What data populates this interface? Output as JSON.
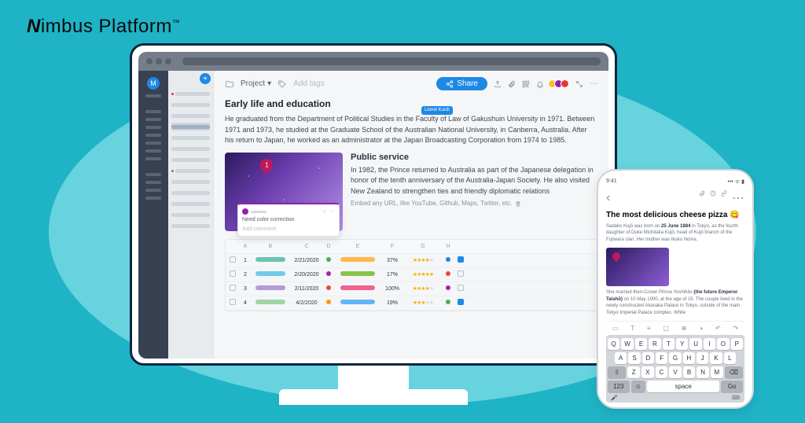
{
  "brand": {
    "name": "Nimbus Platform",
    "tm": "™"
  },
  "rail": {
    "initial": "M"
  },
  "notelist": {
    "add": "+"
  },
  "toolbar": {
    "breadcrumb": "Project",
    "add_tags": "Add tags",
    "share": "Share"
  },
  "doc": {
    "h1": "Early life and education",
    "p1": "He graduated from the Department of Political Studies in the Faculty of Law of Gakushuin University in 1971. Between 1971 and 1973, he studied at the Graduate School of the Australian National University, in Canberra, Australia. After his return to Japan, he worked as an administrator at the Japan Broadcasting Corporation from 1974 to 1985.",
    "cursor_user": "Lionel Kurdi",
    "h2": "Public service",
    "p2": "In 1982, the Prince returned to Australia as part of the Japanese delegation in honor of the tenth anniversary of the Australia-Japan Society. He also visited New Zealand to strengthen ties and friendly diplomatic relations",
    "embed_placeholder": "Embed any URL, like YouTube, Github, Maps, Twitter, etc.",
    "pin": "1"
  },
  "comment": {
    "text": "Need color correction",
    "add": "Add comment"
  },
  "table": {
    "headers": [
      "",
      "A",
      "B",
      "C",
      "D",
      "E",
      "F",
      "G",
      "H",
      ""
    ],
    "rows": [
      {
        "n": "1",
        "pillB": "#69c5b0",
        "date": "2/21/2020",
        "dotD": "#4caf50",
        "pillE": "#ffb74d",
        "pct": "37%",
        "stars": 4,
        "dotH": "#1e88e5",
        "chk": true
      },
      {
        "n": "2",
        "pillB": "#73c9e8",
        "date": "2/20/2020",
        "dotD": "#9c27b0",
        "pillE": "#8bc34a",
        "pct": "17%",
        "stars": 5,
        "dotH": "#f44336",
        "chk": false
      },
      {
        "n": "3",
        "pillB": "#b59bd9",
        "date": "2/11/2020",
        "dotD": "#f44336",
        "pillE": "#f06292",
        "pct": "100%",
        "stars": 4,
        "dotH": "#9c27b0",
        "chk": false
      },
      {
        "n": "4",
        "pillB": "#a2d5a5",
        "date": "4/2/2020",
        "dotD": "#ff9800",
        "pillE": "#64b5f6",
        "pct": "19%",
        "stars": 3,
        "dotH": "#4caf50",
        "chk": true
      }
    ]
  },
  "phone": {
    "time": "9:41",
    "title": "The most delicious cheese pizza",
    "emoji": "😋",
    "p1a": "Sadako Kujō was born on ",
    "p1b": "25 June 1884",
    "p1c": " in Tokyo, as the fourth daughter of Duke Michitaka Kujō, head of Kujō branch of the Fujiwara clan. Her mother was Ikuko Noma.",
    "p2a": "She married then-Crown Prince Yoshihito ",
    "p2b": "(the future Emperor Taishō)",
    "p2c": " on 10 May 1900, at the age of 15. The couple lived in the newly constructed Akasaka Palace in Tokyo, outside of the main Tokyo Imperial Palace complex. While",
    "keys_r1": [
      "Q",
      "W",
      "E",
      "R",
      "T",
      "Y",
      "U",
      "I",
      "O",
      "P"
    ],
    "keys_r2": [
      "A",
      "S",
      "D",
      "F",
      "G",
      "H",
      "J",
      "K",
      "L"
    ],
    "keys_r3": [
      "⇧",
      "Z",
      "X",
      "C",
      "V",
      "B",
      "N",
      "M",
      "⌫"
    ],
    "k_123": "123",
    "k_space": "space",
    "k_go": "Go"
  }
}
